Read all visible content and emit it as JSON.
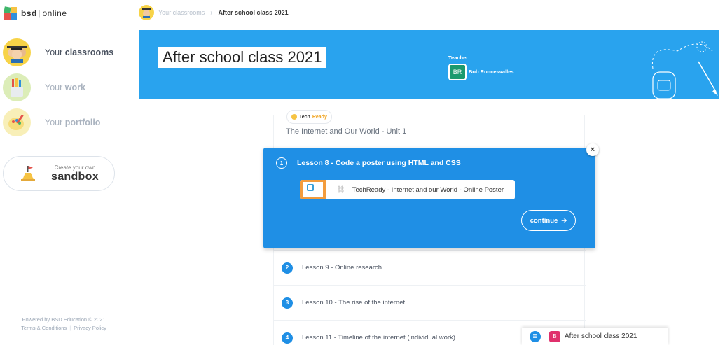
{
  "brand": {
    "name_bold": "bsd",
    "name_rest": "online"
  },
  "sidebar": {
    "items": [
      {
        "prefix": "Your",
        "label": "classrooms",
        "icon": "graduates-icon",
        "active": true
      },
      {
        "prefix": "Your",
        "label": "work",
        "icon": "pencil-cup-icon",
        "active": false
      },
      {
        "prefix": "Your",
        "label": "portfolio",
        "icon": "palette-icon",
        "active": false
      }
    ],
    "sandbox": {
      "small": "Create your own",
      "big": "sandbox"
    },
    "footer": {
      "powered": "Powered by BSD Education © 2021",
      "terms": "Terms & Conditions",
      "privacy": "Privacy Policy"
    }
  },
  "breadcrumb": {
    "parent": "Your classrooms",
    "current": "After school class 2021"
  },
  "banner": {
    "title": "After school class 2021",
    "teacher_label": "Teacher",
    "teacher_initials": "BR",
    "teacher_name": "Bob Roncesvalles",
    "color": "#29a3ee"
  },
  "unit": {
    "tag_prefix": "Tech",
    "tag_accent": "Ready",
    "title": "The Internet and Our World - Unit 1"
  },
  "popover": {
    "number": "1",
    "title": "Lesson 8 - Code a poster using HTML and CSS",
    "resource": "TechReady - Internet and our World - Online Poster",
    "continue_label": "continue",
    "close_label": "×"
  },
  "lessons": [
    {
      "number": "2",
      "label": "Lesson 9 - Online research"
    },
    {
      "number": "3",
      "label": "Lesson 10 - The rise of the internet"
    },
    {
      "number": "4",
      "label": "Lesson 11 - Timeline of the internet (individual work)"
    }
  ],
  "chat": {
    "badge": "B",
    "title": "After school class 2021"
  }
}
